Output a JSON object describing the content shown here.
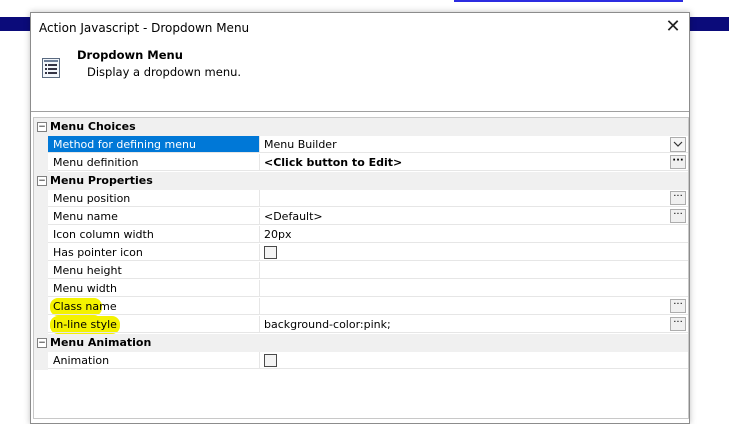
{
  "dialog": {
    "title": "Action Javascript - Dropdown Menu",
    "close_glyph": "✕"
  },
  "header": {
    "title": "Dropdown Menu",
    "description": "Display a dropdown menu."
  },
  "grid": {
    "categories": [
      {
        "label": "Menu Choices",
        "toggle": "−",
        "rows": [
          {
            "name": "Method for defining menu",
            "value": "Menu Builder",
            "selected": true,
            "control": "dropdown"
          },
          {
            "name": "Menu definition",
            "value": "<Click button to Edit>",
            "bold": true,
            "control": "ellipsis"
          }
        ]
      },
      {
        "label": "Menu Properties",
        "toggle": "−",
        "rows": [
          {
            "name": "Menu position",
            "value": "",
            "control": "ellipsis"
          },
          {
            "name": "Menu name",
            "value": "<Default>",
            "control": "ellipsis"
          },
          {
            "name": "Icon column width",
            "value": "20px"
          },
          {
            "name": "Has pointer icon",
            "checkbox": false
          },
          {
            "name": "Menu height",
            "value": ""
          },
          {
            "name": "Menu width",
            "value": ""
          },
          {
            "name": "Class name",
            "value": "",
            "control": "ellipsis",
            "highlighted": true
          },
          {
            "name": "In-line style",
            "value": "background-color:pink;",
            "control": "ellipsis",
            "highlighted": true
          }
        ]
      },
      {
        "label": "Menu Animation",
        "toggle": "−",
        "rows": [
          {
            "name": "Animation",
            "checkbox": false
          }
        ]
      }
    ],
    "ellipsis_glyph": "···"
  },
  "colors": {
    "selection": "#0078d7",
    "highlight": "#f4f200",
    "background_strip": "#0b0b7a"
  }
}
